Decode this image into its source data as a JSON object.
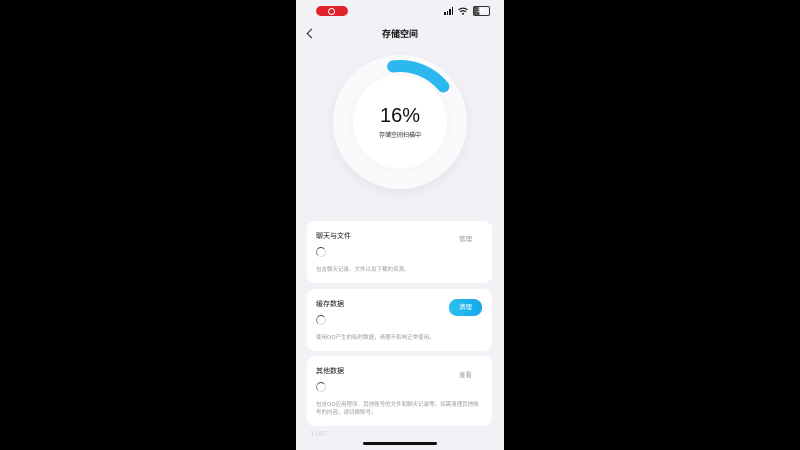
{
  "status_bar": {
    "battery": "37"
  },
  "nav": {
    "title": "存储空间"
  },
  "gauge": {
    "percent_text": "16%",
    "percent_value": 16,
    "label": "存储空间扫描中",
    "accent": "#2ab8ee"
  },
  "cards": [
    {
      "title": "聊天与文件",
      "button": "管理",
      "desc": "包含聊天记录、文件以及下载的资源。"
    },
    {
      "title": "缓存数据",
      "button": "清理",
      "desc": "使用QQ产生的临时数据，清理不影响正常使用。"
    },
    {
      "title": "其他数据",
      "button": "查看",
      "desc": "包含QQ应用程序、其他账号的文件和聊天记录等。如需清理其他账号的内容，请切换账号。"
    }
  ],
  "footer_faint": "1167"
}
